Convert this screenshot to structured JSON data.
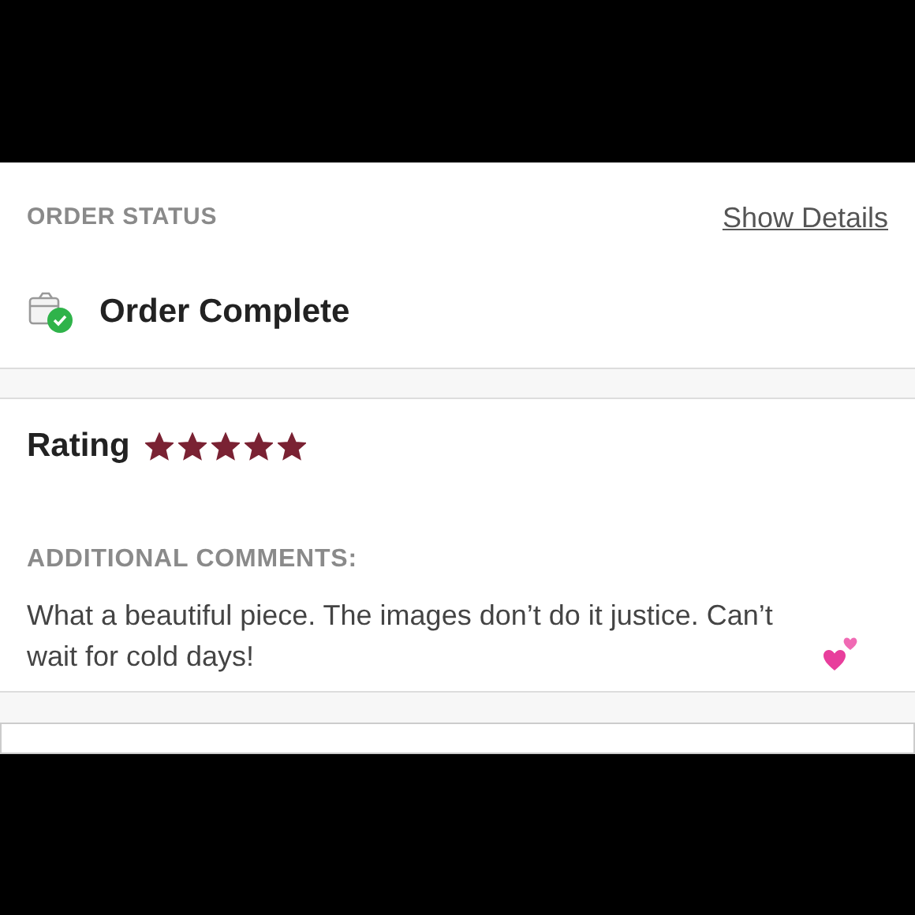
{
  "order_status": {
    "heading": "ORDER STATUS",
    "link": "Show Details",
    "status": "Order Complete",
    "complete": true
  },
  "rating": {
    "label": "Rating",
    "stars": 5
  },
  "comments": {
    "heading": "ADDITIONAL COMMENTS:",
    "text": "What a beautiful piece. The images don’t do it justice. Can’t wait for cold days!"
  }
}
